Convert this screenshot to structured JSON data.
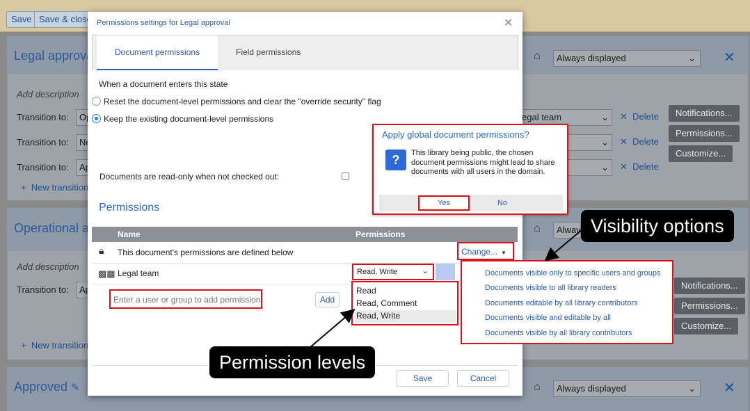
{
  "background": {
    "toolbar": {
      "save": "Save",
      "save_close": "Save & close"
    },
    "panels": [
      {
        "title": "Legal approval",
        "visibility": "Always displayed",
        "add_description": "Add description",
        "transitions": [
          {
            "label": "Transition to:",
            "target": "Op",
            "assignee": "egal team"
          },
          {
            "label": "Transition to:",
            "target": "Ne"
          },
          {
            "label": "Transition to:",
            "target": "Ap"
          }
        ],
        "new_transition": "New transition"
      },
      {
        "title": "Operational a",
        "visibility": "Alway",
        "add_description": "Add description",
        "transitions": [
          {
            "label": "Transition to:",
            "target": "Ap"
          }
        ],
        "new_transition": "New transition"
      },
      {
        "title": "Approved",
        "visibility": "Always displayed"
      }
    ],
    "delete_label": "Delete",
    "buttons": {
      "notifications": "Notifications...",
      "permissions": "Permissions...",
      "customize": "Customize..."
    }
  },
  "dialog": {
    "title": "Permissions settings for Legal approval",
    "tabs": [
      {
        "label": "Document permissions",
        "active": true
      },
      {
        "label": "Field permissions",
        "active": false
      }
    ],
    "state_intro": "When a document enters this state",
    "options": [
      {
        "label": "Reset the document-level permissions and clear the \"override security\" flag",
        "selected": false
      },
      {
        "label": "Keep the existing document-level permissions",
        "selected": true
      }
    ],
    "readonly_label": "Documents are read-only when not checked out:",
    "permissions_heading": "Permissions",
    "table": {
      "columns": [
        "Name",
        "Permissions"
      ],
      "defined_row": "This document's permissions are defined below",
      "change_link": "Change...",
      "rows": [
        {
          "name": "Legal team",
          "permission": "Read, Write"
        }
      ]
    },
    "add_placeholder": "Enter a user or group to add permissions",
    "add_button": "Add",
    "permission_levels": [
      "Read",
      "Read, Comment",
      "Read, Write"
    ],
    "footer": {
      "save": "Save",
      "cancel": "Cancel"
    }
  },
  "confirm": {
    "title": "Apply global document permissions?",
    "message": "This library being public, the chosen document permissions might lead to share documents with all users in the domain.",
    "yes": "Yes",
    "no": "No"
  },
  "visibility_menu": [
    "Documents visible only to specific users and groups",
    "Documents visible to all library readers",
    "Documents editable by all library contributors",
    "Documents visible and editable by all",
    "Documents visible by all library contributors"
  ],
  "callouts": {
    "visibility": "Visibility options",
    "permission_levels": "Permission levels"
  },
  "colors": {
    "accent": "#2d6ad6",
    "highlight_red": "#d9121b",
    "callout_bg": "#000000"
  }
}
